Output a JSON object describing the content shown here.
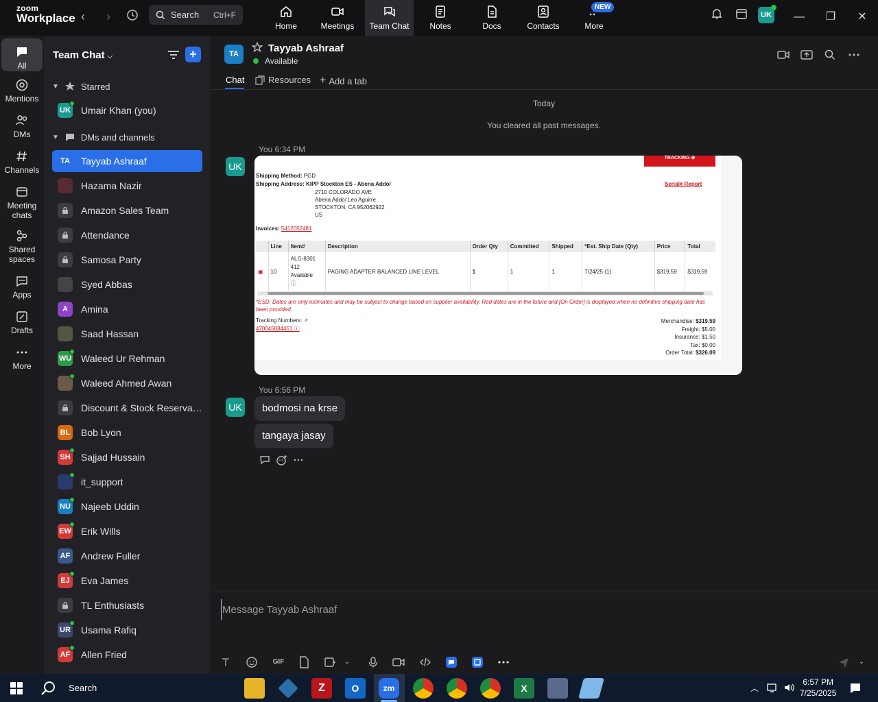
{
  "app": {
    "logo_top": "zoom",
    "logo_bottom": "Workplace",
    "search_label": "Search",
    "search_shortcut": "Ctrl+F",
    "tabs": [
      {
        "label": "Home"
      },
      {
        "label": "Meetings"
      },
      {
        "label": "Team Chat"
      },
      {
        "label": "Notes"
      },
      {
        "label": "Docs"
      },
      {
        "label": "Contacts"
      },
      {
        "label": "More"
      }
    ],
    "new_badge": "NEW",
    "profile_initials": "UK"
  },
  "rail": [
    {
      "label": "All"
    },
    {
      "label": "Mentions"
    },
    {
      "label": "DMs"
    },
    {
      "label": "Channels"
    },
    {
      "label": "Meeting chats"
    },
    {
      "label": "Shared spaces"
    },
    {
      "label": "Apps"
    },
    {
      "label": "Drafts"
    },
    {
      "label": "More"
    }
  ],
  "sidebar": {
    "title": "Team Chat",
    "starred_label": "Starred",
    "dms_label": "DMs and channels",
    "starred": [
      {
        "initials": "UK",
        "name": "Umair Khan (you)",
        "color": "#1a9b8e",
        "online": true
      }
    ],
    "items": [
      {
        "initials": "TA",
        "name": "Tayyab Ashraaf",
        "color": "#1a7fc6",
        "online": false
      },
      {
        "initials": "",
        "name": "Hazama Nazir",
        "color": "#5a2a33",
        "online": false
      },
      {
        "initials": "",
        "name": "Amazon Sales Team",
        "color": "#3c3c42",
        "online": false,
        "lock": true
      },
      {
        "initials": "",
        "name": "Attendance",
        "color": "#3c3c42",
        "online": false,
        "lock": true
      },
      {
        "initials": "",
        "name": "Samosa Party",
        "color": "#3c3c42",
        "online": false,
        "lock": true
      },
      {
        "initials": "",
        "name": "Syed Abbas",
        "color": "#444",
        "online": false
      },
      {
        "initials": "A",
        "name": "Amina",
        "color": "#8e44c6",
        "online": false
      },
      {
        "initials": "",
        "name": "Saad Hassan",
        "color": "#554",
        "online": false
      },
      {
        "initials": "WU",
        "name": "Waleed Ur Rehman",
        "color": "#2e9b4a",
        "online": true
      },
      {
        "initials": "",
        "name": "Waleed Ahmed Awan",
        "color": "#6b5a4a",
        "online": true
      },
      {
        "initials": "",
        "name": "Discount & Stock Reservati...",
        "color": "#3c3c42",
        "online": false,
        "lock": true
      },
      {
        "initials": "BL",
        "name": "Bob Lyon",
        "color": "#d86a10",
        "online": false
      },
      {
        "initials": "SH",
        "name": "Sajjad Hussain",
        "color": "#d23a3a",
        "online": true
      },
      {
        "initials": "",
        "name": "it_support",
        "color": "#2a3a6e",
        "online": true
      },
      {
        "initials": "NU",
        "name": "Najeeb Uddin",
        "color": "#1a7fc6",
        "online": true
      },
      {
        "initials": "EW",
        "name": "Erik Wills",
        "color": "#d23a3a",
        "online": true
      },
      {
        "initials": "AF",
        "name": "Andrew Fuller",
        "color": "#3a5a8e",
        "online": false
      },
      {
        "initials": "EJ",
        "name": "Eva James",
        "color": "#d23a3a",
        "online": true
      },
      {
        "initials": "",
        "name": "TL Enthusiasts",
        "color": "#3c3c42",
        "online": false,
        "lock": true
      },
      {
        "initials": "UR",
        "name": "Usama Rafiq",
        "color": "#3a4a6e",
        "online": true
      },
      {
        "initials": "AF",
        "name": "Allen Fried",
        "color": "#d23a3a",
        "online": true
      }
    ]
  },
  "chat": {
    "contact_initials": "TA",
    "contact_name": "Tayyab Ashraaf",
    "status": "Available",
    "tabs": [
      {
        "label": "Chat"
      },
      {
        "label": "Resources"
      },
      {
        "label": "Add a tab"
      }
    ],
    "day_label": "Today",
    "cleared_label": "You cleared all past messages.",
    "msg1_meta": "You 6:34 PM",
    "msg2_meta": "You 6:56 PM",
    "sender_initials": "UK",
    "bubbles": [
      "bodmosi na krse",
      "tangaya jasay"
    ],
    "composer_placeholder": "Message Tayyab Ashraaf",
    "composer_gif": "GIF"
  },
  "order": {
    "tracking_btn": "TRACKING ⊕",
    "ship_method_label": "Shipping Method:",
    "ship_method": "PGD",
    "ship_address_label": "Shipping Address:",
    "address_line1": "KIPP Stockton ES - Abena Addo/",
    "address_line2": "2710 COLORADO AVE",
    "address_line3": "Abena Addo/ Leo Aguirre",
    "address_line4": "STOCKTON, CA 952062922",
    "address_line5": "US",
    "serial_report": "Serial# Report",
    "invoices_label": "Invoices:",
    "invoice_no": "5412052481",
    "headers": [
      "Line",
      "Item#",
      "Description",
      "Order Qty",
      "Committed",
      "Shipped",
      "*Est. Ship Date (Qty)",
      "Price",
      "Total"
    ],
    "row": {
      "line": "10",
      "item_a": "ALG-8301",
      "item_b": "412",
      "item_c": "Available",
      "description": "PAGING ADAPTER BALANCED LINE LEVEL",
      "order_qty": "1",
      "committed": "1",
      "shipped": "1",
      "ship_date": "7/24/25 (1)",
      "price": "$319.59",
      "total": "$319.59"
    },
    "esd_note": "*ESD: Dates are only estimates and may be subject to change based on supplier availability. Red dates are in the future and [On Order] is displayed when no definitive shipping date has been provided.",
    "tracking_label": "Tracking Numbers:",
    "tracking_no": "470045084451",
    "merch_label": "Merchandise:",
    "merch": "$319.59",
    "freight_label": "Freight:",
    "freight": "$5.00",
    "insurance_label": "Insurance:",
    "insurance": "$1.50",
    "tax_label": "Tax:",
    "tax": "$0.00",
    "total_label": "Order Total:",
    "total": "$326.09"
  },
  "taskbar": {
    "search_label": "Search",
    "time": "6:57 PM",
    "date": "7/25/2025"
  }
}
